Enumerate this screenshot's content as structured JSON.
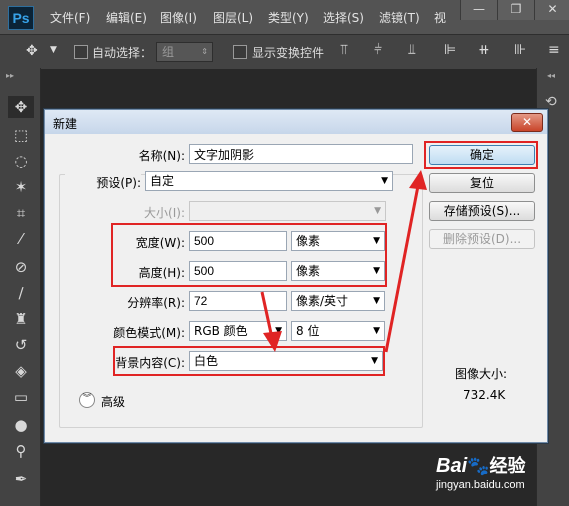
{
  "app": {
    "logo": "Ps",
    "menu": [
      "文件(F)",
      "编辑(E)",
      "图像(I)",
      "图层(L)",
      "类型(Y)",
      "选择(S)",
      "滤镜(T)",
      "视"
    ],
    "window_controls": [
      "—",
      "❐",
      "✕"
    ]
  },
  "options_bar": {
    "auto_select_label": "自动选择：",
    "auto_select_value": "组",
    "show_transform_label": "显示变换控件"
  },
  "dialog": {
    "title": "新建",
    "close": "✕",
    "name_label": "名称(N):",
    "name_value": "文字加阴影",
    "preset_label": "预设(P):",
    "preset_value": "自定",
    "size_label": "大小(I):",
    "size_value": "",
    "width_label": "宽度(W):",
    "width_value": "500",
    "width_unit": "像素",
    "height_label": "高度(H):",
    "height_value": "500",
    "height_unit": "像素",
    "resolution_label": "分辨率(R):",
    "resolution_value": "72",
    "resolution_unit": "像素/英寸",
    "color_mode_label": "颜色模式(M):",
    "color_mode_value": "RGB 颜色",
    "bit_depth_value": "8 位",
    "background_label": "背景内容(C):",
    "background_value": "白色",
    "advanced_label": "高级",
    "buttons": {
      "ok": "确定",
      "reset": "复位",
      "save_preset": "存储预设(S)...",
      "delete_preset": "删除预设(D)..."
    },
    "image_size_label": "图像大小:",
    "image_size_value": "732.4K"
  },
  "watermark": {
    "brand": "Bai",
    "brand_suffix": "经验",
    "url": "jingyan.baidu.com"
  },
  "colors": {
    "highlight": "#e02424",
    "menubar": "#535353",
    "workspace": "#282828"
  }
}
